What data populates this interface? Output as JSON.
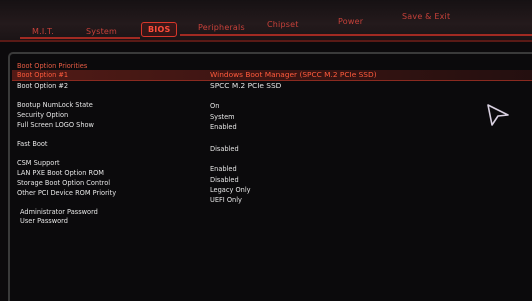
{
  "tabs": [
    {
      "label": "M.I.T."
    },
    {
      "label": "System"
    },
    {
      "label": "BIOS"
    },
    {
      "label": "Peripherals"
    },
    {
      "label": "Chipset"
    },
    {
      "label": "Power"
    },
    {
      "label": "Save & Exit"
    }
  ],
  "active_tab": "BIOS",
  "section": {
    "heading": "Boot Option Priorities"
  },
  "options": [
    {
      "label": "Boot Option #1",
      "value": "Windows Boot Manager (SPCC M.2 PCIe SSD)"
    },
    {
      "label": "Boot Option #2",
      "value": "SPCC M.2 PCIe SSD"
    },
    {
      "label": "Bootup NumLock State",
      "value": "On"
    },
    {
      "label": "Security Option",
      "value": "System"
    },
    {
      "label": "Full Screen LOGO Show",
      "value": "Enabled"
    },
    {
      "label": "Fast Boot",
      "value": "Disabled"
    },
    {
      "label": "CSM Support",
      "value": "Enabled"
    },
    {
      "label": "LAN PXE Boot Option ROM",
      "value": "Disabled"
    },
    {
      "label": "Storage Boot Option Control",
      "value": "Legacy Only"
    },
    {
      "label": "Other PCI Device ROM Priority",
      "value": "UEFI Only"
    },
    {
      "label": "Administrator Password",
      "value": ""
    },
    {
      "label": "User Password",
      "value": ""
    }
  ],
  "colors": {
    "accent": "#ff4c3a",
    "highlight": "#8a2a20",
    "text": "#e6e6e6",
    "background": "#0b0a0c"
  }
}
